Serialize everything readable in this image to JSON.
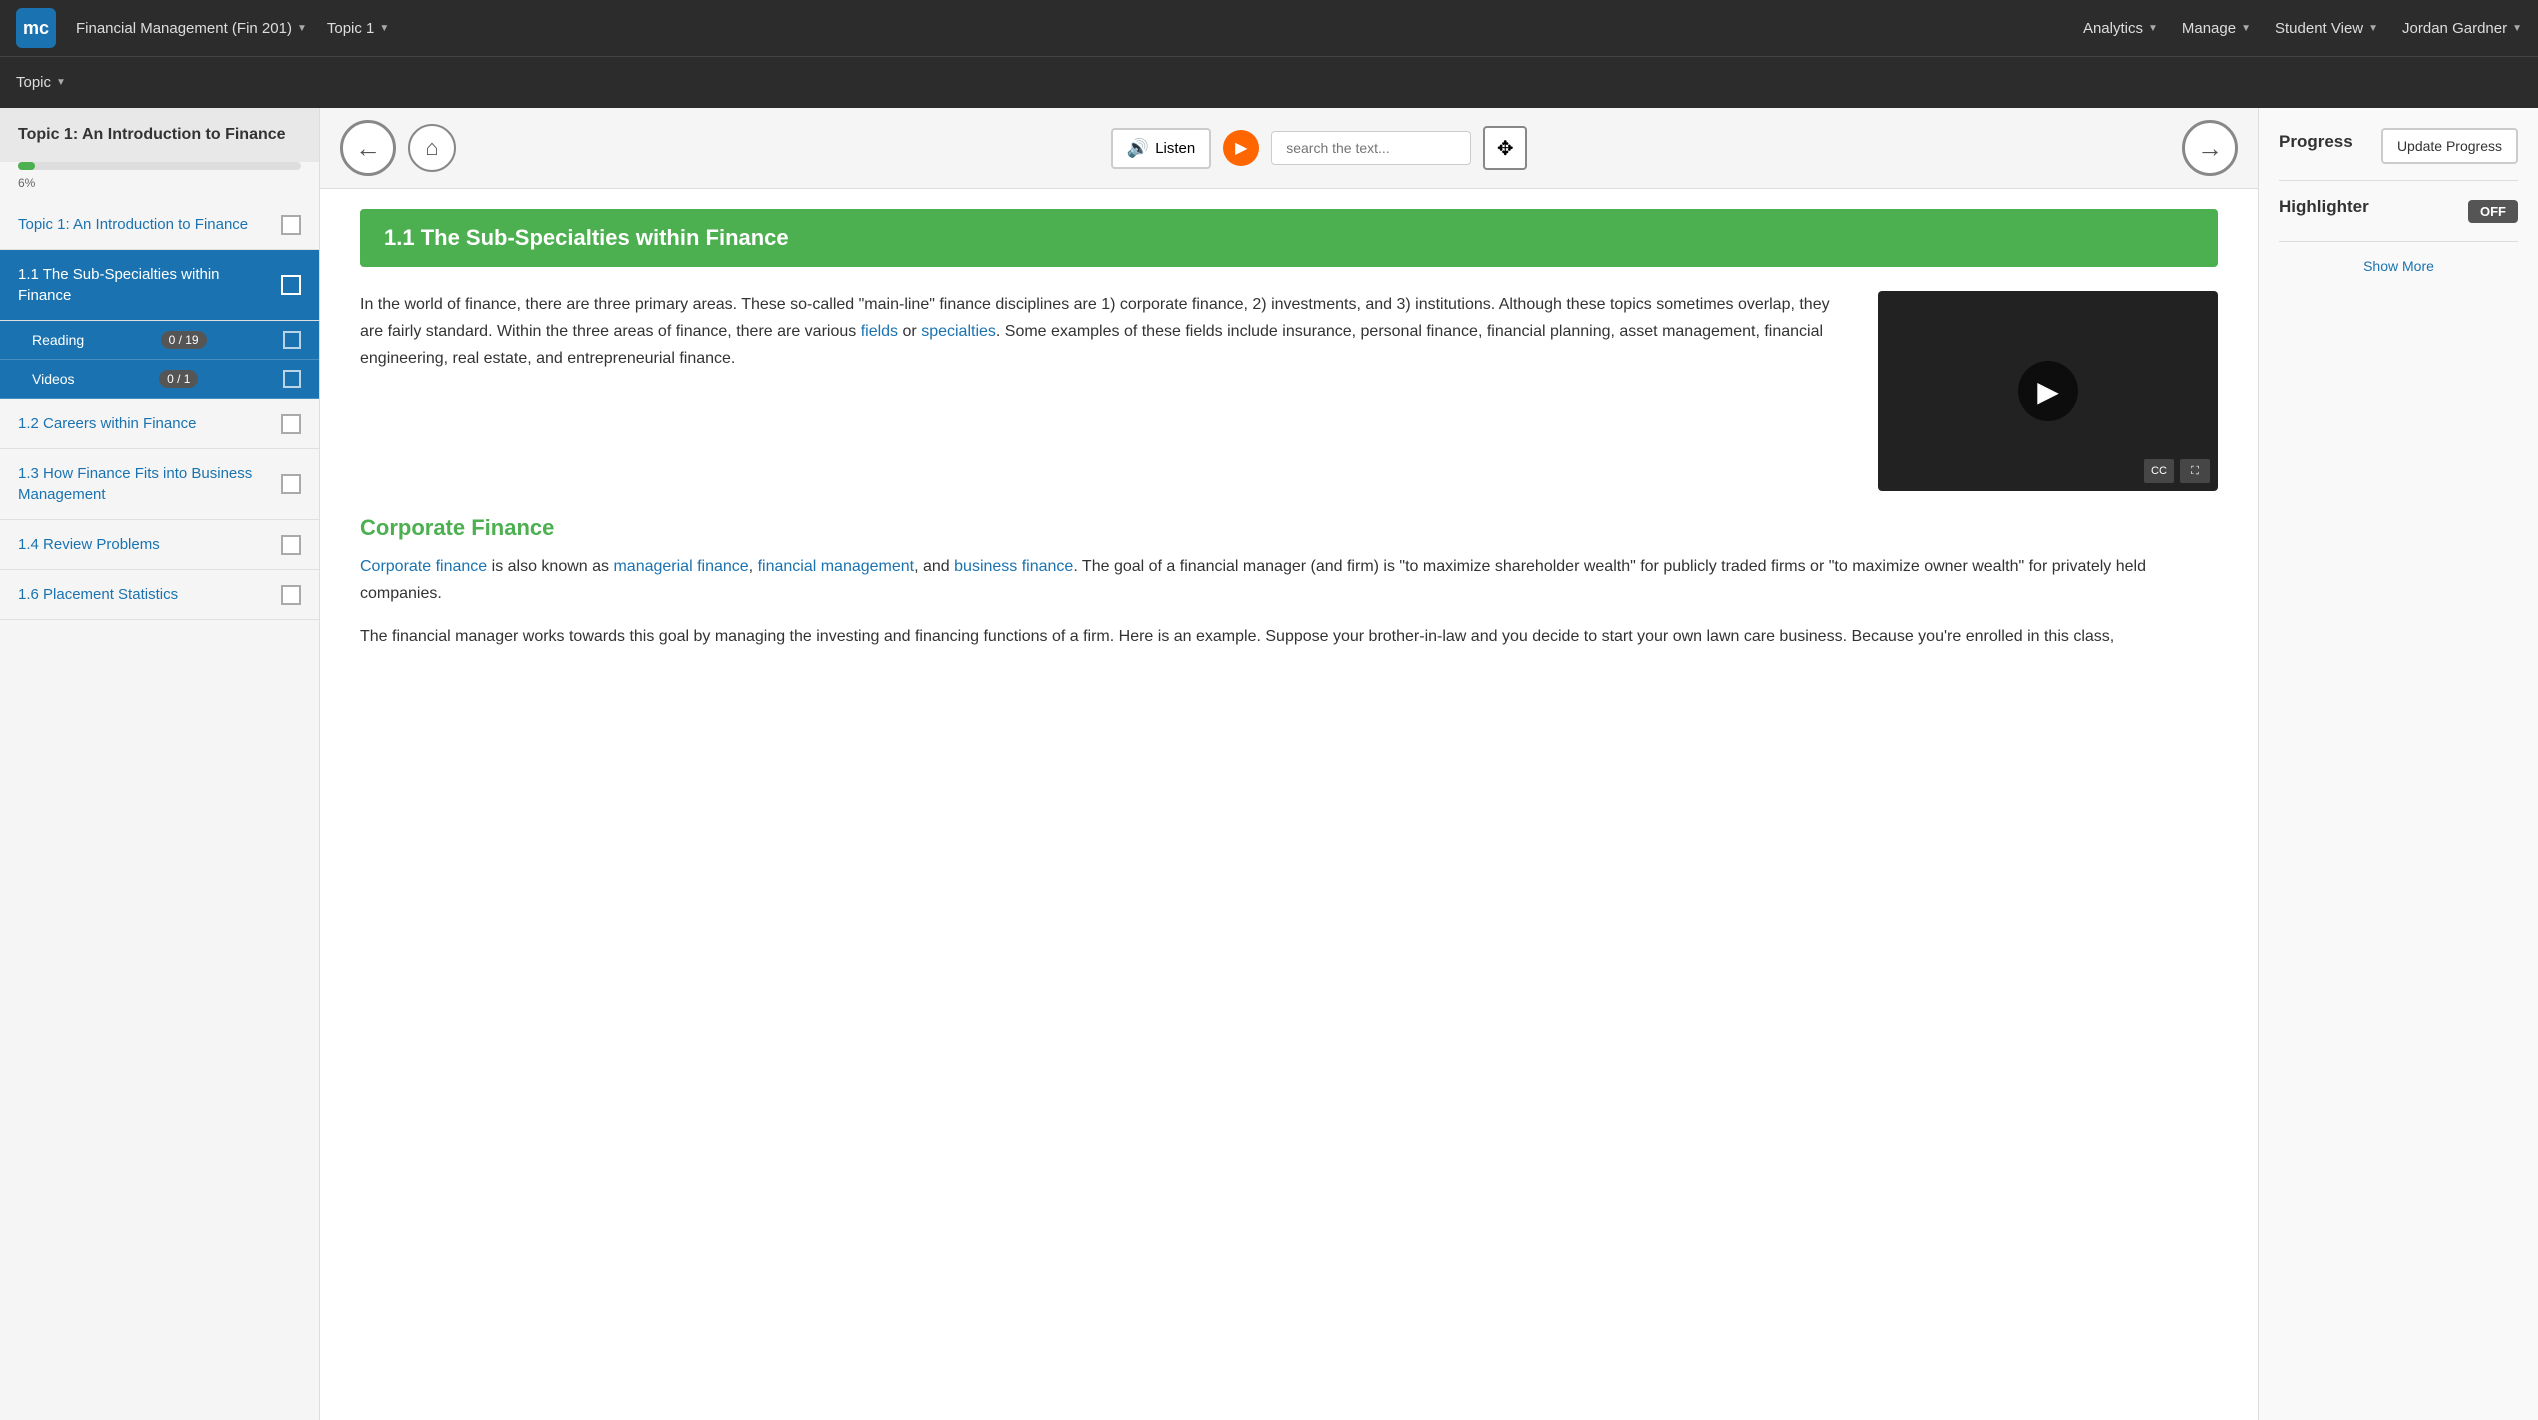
{
  "topNav": {
    "logo": "mc",
    "courseTitle": "Financial Management (Fin 201)",
    "topicDropdown": "Topic 1",
    "analyticsLabel": "Analytics",
    "manageLabel": "Manage",
    "studentViewLabel": "Student View",
    "userLabel": "Jordan Gardner"
  },
  "secondNav": {
    "topicLabel": "Topic"
  },
  "sidebar": {
    "title": "Topic 1: An Introduction to Finance",
    "progressPercent": 6,
    "progressLabel": "6%",
    "items": [
      {
        "id": "topic-intro",
        "label": "Topic 1: An Introduction to Finance",
        "active": false,
        "subitems": []
      },
      {
        "id": "section-1-1",
        "label": "1.1 The Sub-Specialties within Finance",
        "active": true,
        "subitems": [
          {
            "id": "reading",
            "label": "Reading",
            "badge": "0 / 19"
          },
          {
            "id": "videos",
            "label": "Videos",
            "badge": "0 / 1"
          }
        ]
      },
      {
        "id": "section-1-2",
        "label": "1.2 Careers within Finance",
        "active": false,
        "subitems": []
      },
      {
        "id": "section-1-3",
        "label": "1.3 How Finance Fits into Business Management",
        "active": false,
        "subitems": []
      },
      {
        "id": "section-1-4",
        "label": "1.4 Review Problems",
        "active": false,
        "subitems": []
      },
      {
        "id": "section-1-6",
        "label": "1.6 Placement Statistics",
        "active": false,
        "subitems": []
      }
    ]
  },
  "toolbar": {
    "listenLabel": "Listen",
    "searchPlaceholder": "search the text..."
  },
  "content": {
    "sectionTitle": "1.1  The Sub-Specialties within Finance",
    "introParagraph": "In the world of finance, there are three primary areas. These so-called \"main-line\" finance disciplines are 1) corporate finance, 2) investments, and 3) institutions. Although these topics sometimes overlap, they are fairly standard. Within the three areas of finance, there are various fields or specialties. Some examples of these fields include insurance, personal finance, financial planning, asset management, financial engineering, real estate, and entrepreneurial finance.",
    "fieldsLink": "fields",
    "specialtiesLink": "specialties",
    "subsectionTitle": "Corporate Finance",
    "corporateFinanceText": "Corporate finance is also known as managerial finance, financial management, and business finance. The goal of a financial manager (and firm) is \"to maximize shareholder wealth\" for publicly traded firms or \"to maximize owner wealth\" for privately held companies.",
    "corporateFinanceLink1": "Corporate finance",
    "corporateFinanceLink2": "managerial finance",
    "corporateFinanceLink3": "financial management",
    "corporateFinanceLink4": "business finance",
    "bodyText2": "The financial manager works towards this goal by managing the investing and financing functions of a firm. Here is an example. Suppose your brother-in-law and you decide to start your own lawn care business. Because you're enrolled in this class,"
  },
  "rightPanel": {
    "progressLabel": "Progress",
    "updateProgressLabel": "Update Progress",
    "highlighterLabel": "Highlighter",
    "toggleLabel": "OFF",
    "showMoreLabel": "Show More"
  }
}
